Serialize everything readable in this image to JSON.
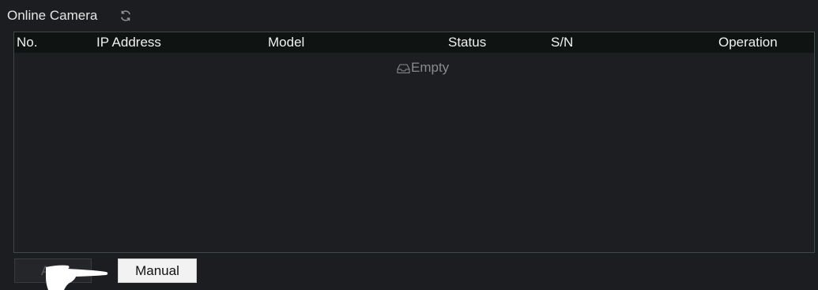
{
  "header": {
    "title": "Online Camera",
    "refresh_icon": "refresh-icon"
  },
  "table": {
    "columns": [
      "No.",
      "IP Address",
      "Model",
      "Status",
      "S/N",
      "Operation"
    ],
    "rows": [],
    "empty_text": "Empty",
    "empty_icon": "empty-tray-icon"
  },
  "footer": {
    "add_label": "Add",
    "add_disabled": true,
    "manual_label": "Manual"
  },
  "colors": {
    "background": "#1c1d20",
    "table_header": "#0f1413",
    "table_border": "#3b4947",
    "empty_text": "#8a8b8f",
    "manual_button": "#f2f2f2"
  }
}
